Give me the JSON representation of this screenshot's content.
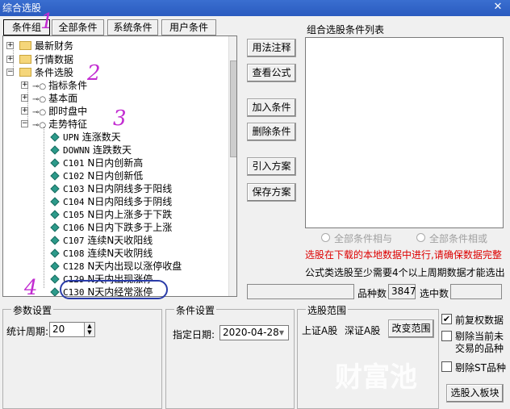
{
  "window": {
    "title": "综合选股",
    "close": "✕"
  },
  "tabs": [
    "条件组",
    "全部条件",
    "系统条件",
    "用户条件"
  ],
  "tree": {
    "top_items": [
      "最新财务",
      "行情数据",
      "条件选股"
    ],
    "sub_items": [
      "指标条件",
      "基本面",
      "即时盘中",
      "走势特征"
    ],
    "leaves": [
      {
        "code": "UPN",
        "name": "连涨数天"
      },
      {
        "code": "DOWNN",
        "name": "连跌数天"
      },
      {
        "code": "C101",
        "name": "N日内创新高"
      },
      {
        "code": "C102",
        "name": "N日内创新低"
      },
      {
        "code": "C103",
        "name": "N日内阴线多于阳线"
      },
      {
        "code": "C104",
        "name": "N日内阳线多于阴线"
      },
      {
        "code": "C105",
        "name": "N日内上涨多于下跌"
      },
      {
        "code": "C106",
        "name": "N日内下跌多于上涨"
      },
      {
        "code": "C107",
        "name": "连续N天收阳线"
      },
      {
        "code": "C108",
        "name": "连续N天收阴线"
      },
      {
        "code": "C128",
        "name": "N天内出现以涨停收盘"
      },
      {
        "code": "C129",
        "name": "N天内出现涨停"
      },
      {
        "code": "C130",
        "name": "N天内经常涨停"
      }
    ]
  },
  "buttons": {
    "usage": "用法注释",
    "formula": "查看公式",
    "add": "加入条件",
    "delete": "删除条件",
    "import": "引入方案",
    "save": "保存方案",
    "change_range": "改变范围",
    "select_board": "选股入板块"
  },
  "list": {
    "title": "组合选股条件列表"
  },
  "logic": {
    "and": "全部条件相与",
    "or": "全部条件相或"
  },
  "notes": {
    "warning": "选股在下载的本地数据中进行,请确保数据完整",
    "formula_note": "公式类选股至少需要4个以上周期数据才能选出"
  },
  "stats": {
    "count_label": "品种数",
    "count_value": "3847",
    "selected_label": "选中数"
  },
  "params": {
    "group": "参数设置",
    "period_label": "统计周期:",
    "period_value": "20"
  },
  "condition": {
    "group": "条件设置",
    "date_label": "指定日期:",
    "date_value": "2020-04-28"
  },
  "range": {
    "group": "选股范围",
    "sh": "上证A股",
    "sz": "深证A股"
  },
  "options": {
    "fq": "前复权数据",
    "exclude1": "剔除当前未",
    "exclude2": "交易的品种",
    "exclude3": "剔除ST品种"
  },
  "annotations": [
    "1",
    "2",
    "3",
    "4"
  ],
  "watermark": "财富池"
}
